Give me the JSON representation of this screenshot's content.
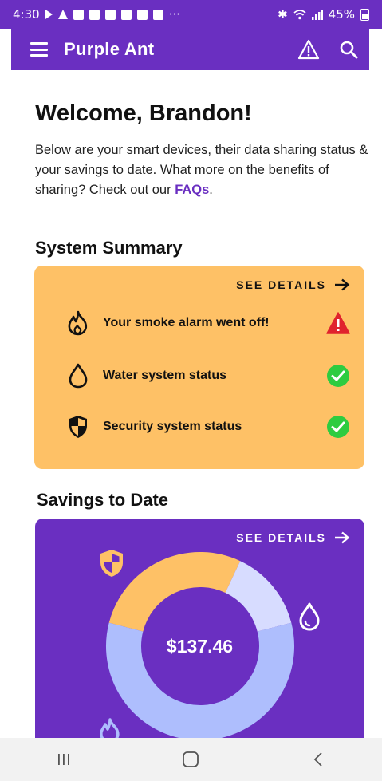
{
  "status_bar": {
    "time": "4:30",
    "battery": "45%"
  },
  "app_bar": {
    "title": "Purple Ant",
    "icons": [
      "menu-icon",
      "warning-icon",
      "search-icon"
    ]
  },
  "welcome": {
    "heading": "Welcome, Brandon!",
    "intro_text": "Below are your smart devices, their data sharing status & your savings to date. What more on the benefits of sharing? Check out our ",
    "faq_link": "FAQs",
    "intro_end": "."
  },
  "system_summary": {
    "title": "System Summary",
    "see_details": "SEE DETAILS",
    "items": [
      {
        "label": "Your smoke alarm went off!",
        "icon": "fire-icon",
        "status": "alert"
      },
      {
        "label": "Water system status",
        "icon": "water-drop-icon",
        "status": "ok"
      },
      {
        "label": "Security system status",
        "icon": "shield-icon",
        "status": "ok"
      }
    ]
  },
  "savings": {
    "title": "Savings to Date",
    "see_details": "SEE DETAILS",
    "amount": "$137.46",
    "segments": [
      {
        "category": "security",
        "color": "#fec166",
        "fraction": 0.28
      },
      {
        "category": "water",
        "color": "#d7dcff",
        "fraction": 0.14
      },
      {
        "category": "fire",
        "color": "#aebefd",
        "fraction": 0.58
      }
    ]
  },
  "colors": {
    "brand_purple": "#6a2fc1",
    "summary_card": "#fec166",
    "alert_red": "#e0232d",
    "ok_green": "#2ecc40"
  }
}
